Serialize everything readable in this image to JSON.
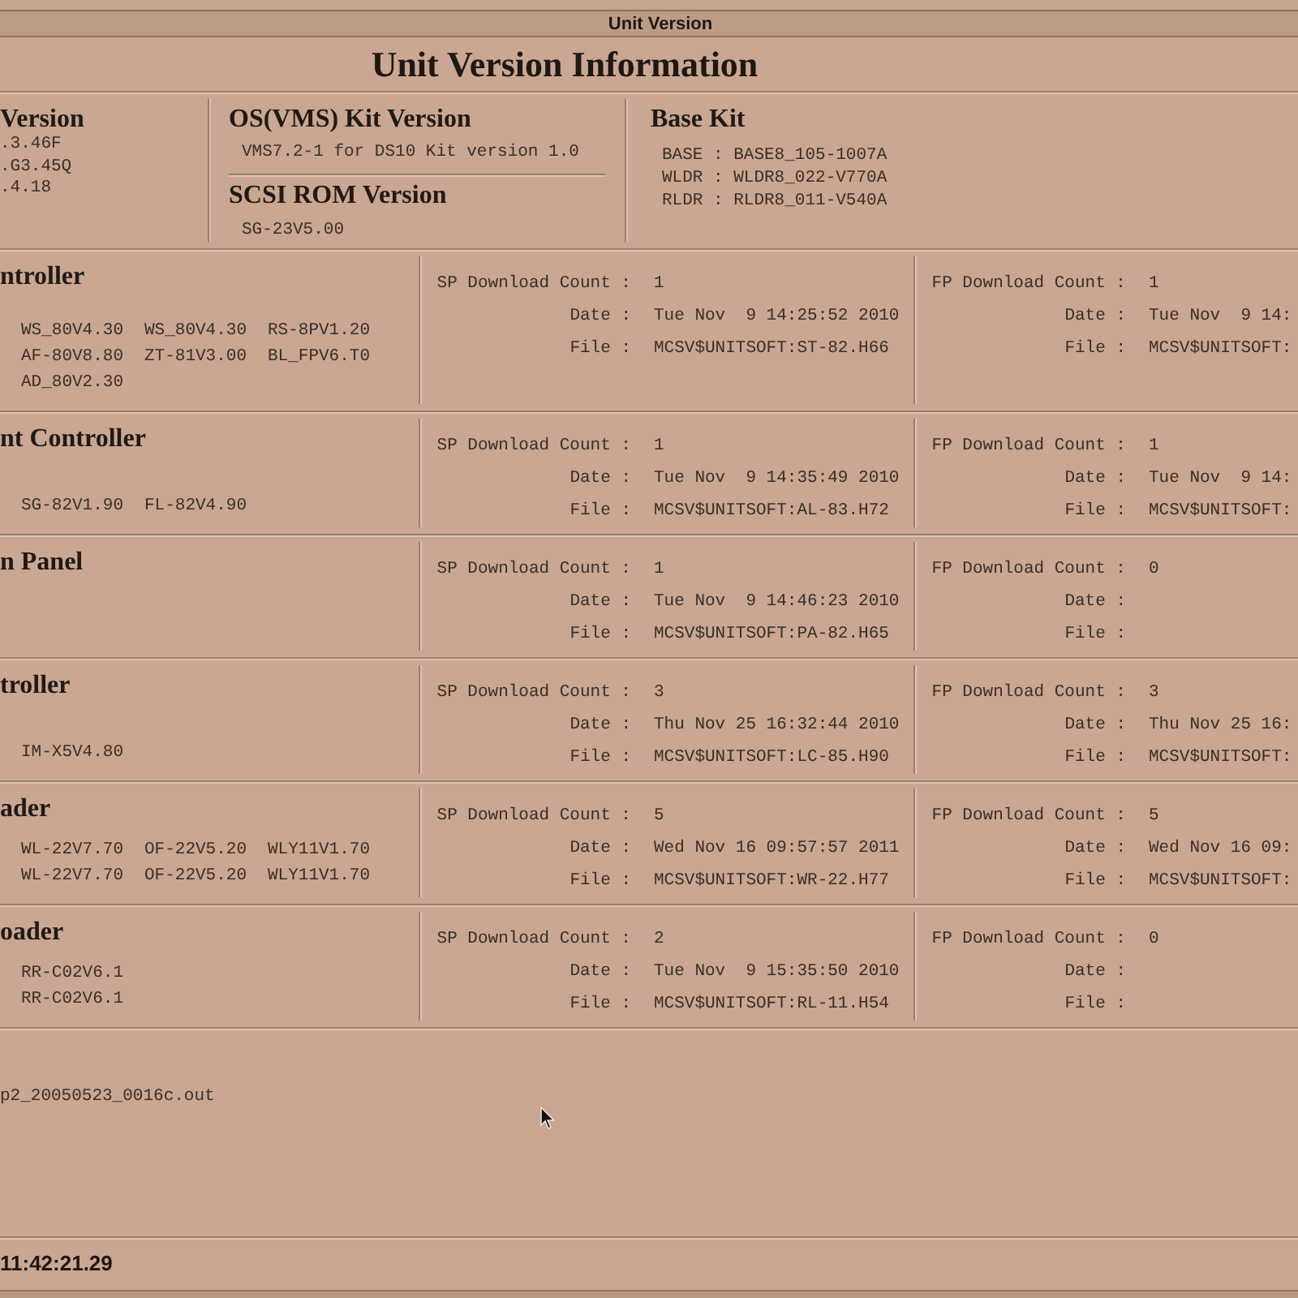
{
  "window": {
    "title": "Unit Version"
  },
  "heading": "Unit Version Information",
  "summary": {
    "columns": [
      {
        "blocks": [
          {
            "title": "Version",
            "lines": [
              ".3.46F",
              ".G3.45Q",
              ".4.18"
            ]
          }
        ]
      },
      {
        "blocks": [
          {
            "title": "OS(VMS) Kit Version",
            "lines": [
              "VMS7.2-1 for DS10 Kit version 1.0"
            ]
          },
          {
            "title": "SCSI ROM Version",
            "lines": [
              "SG-23V5.00"
            ]
          }
        ]
      },
      {
        "blocks": [
          {
            "title": "Base Kit",
            "lines": [
              "BASE : BASE8_105-1007A",
              "WLDR : WLDR8_022-V770A",
              "RLDR : RLDR8_011-V540A"
            ]
          }
        ]
      }
    ]
  },
  "units": [
    {
      "title": "ntroller",
      "versions": [
        [
          "WS_80V4.30",
          "WS_80V4.30",
          "RS-8PV1.20"
        ],
        [
          "AF-80V8.80",
          "ZT-81V3.00",
          "BL_FPV6.T0"
        ],
        [
          "AD_80V2.30"
        ]
      ],
      "sp": [
        {
          "label": "SP Download Count :",
          "value": "1"
        },
        {
          "label": "Date :",
          "value": "Tue Nov  9 14:25:52 2010"
        },
        {
          "label": "File :",
          "value": "MCSV$UNITSOFT:ST-82.H66"
        }
      ],
      "fp": [
        {
          "label": "FP Download Count :",
          "value": "1"
        },
        {
          "label": "Date :",
          "value": "Tue Nov  9 14:"
        },
        {
          "label": "File :",
          "value": "MCSV$UNITSOFT:"
        }
      ]
    },
    {
      "title": "nt Controller",
      "versions": [
        [
          "SG-82V1.90",
          "FL-82V4.90"
        ]
      ],
      "sp": [
        {
          "label": "SP Download Count :",
          "value": "1"
        },
        {
          "label": "Date :",
          "value": "Tue Nov  9 14:35:49 2010"
        },
        {
          "label": "File :",
          "value": "MCSV$UNITSOFT:AL-83.H72"
        }
      ],
      "fp": [
        {
          "label": "FP Download Count :",
          "value": "1"
        },
        {
          "label": "Date :",
          "value": "Tue Nov  9 14:"
        },
        {
          "label": "File :",
          "value": "MCSV$UNITSOFT:"
        }
      ]
    },
    {
      "title": "n Panel",
      "sp": [
        {
          "label": "SP Download Count :",
          "value": "1"
        },
        {
          "label": "Date :",
          "value": "Tue Nov  9 14:46:23 2010"
        },
        {
          "label": "File :",
          "value": "MCSV$UNITSOFT:PA-82.H65"
        }
      ],
      "fp": [
        {
          "label": "FP Download Count :",
          "value": "0"
        },
        {
          "label": "Date :"
        },
        {
          "label": "File :"
        }
      ]
    },
    {
      "title": "troller",
      "versions": [
        [
          "IM-X5V4.80"
        ]
      ],
      "sp": [
        {
          "label": "SP Download Count :",
          "value": "3"
        },
        {
          "label": "Date :",
          "value": "Thu Nov 25 16:32:44 2010"
        },
        {
          "label": "File :",
          "value": "MCSV$UNITSOFT:LC-85.H90"
        }
      ],
      "fp": [
        {
          "label": "FP Download Count :",
          "value": "3"
        },
        {
          "label": "Date :",
          "value": "Thu Nov 25 16:"
        },
        {
          "label": "File :",
          "value": "MCSV$UNITSOFT:"
        }
      ]
    },
    {
      "title": "ader",
      "versions": [
        [
          "WL-22V7.70",
          "OF-22V5.20",
          "WLY11V1.70"
        ],
        [
          "WL-22V7.70",
          "OF-22V5.20",
          "WLY11V1.70"
        ]
      ],
      "sp": [
        {
          "label": "SP Download Count :",
          "value": "5"
        },
        {
          "label": "Date :",
          "value": "Wed Nov 16 09:57:57 2011"
        },
        {
          "label": "File :",
          "value": "MCSV$UNITSOFT:WR-22.H77"
        }
      ],
      "fp": [
        {
          "label": "FP Download Count :",
          "value": "5"
        },
        {
          "label": "Date :",
          "value": "Wed Nov 16 09:"
        },
        {
          "label": "File :",
          "value": "MCSV$UNITSOFT:"
        }
      ]
    },
    {
      "title": "oader",
      "versions": [
        [
          "RR-C02V6.1"
        ],
        [
          "RR-C02V6.1"
        ]
      ],
      "sp": [
        {
          "label": "SP Download Count :",
          "value": "2"
        },
        {
          "label": "Date :",
          "value": "Tue Nov  9 15:35:50 2010"
        },
        {
          "label": "File :",
          "value": "MCSV$UNITSOFT:RL-11.H54"
        }
      ],
      "fp": [
        {
          "label": "FP Download Count :",
          "value": "0"
        },
        {
          "label": "Date :"
        },
        {
          "label": "File :"
        }
      ]
    }
  ],
  "log_file": "p2_20050523_0016c.out",
  "status_bar": {
    "time": "11:42:21.29"
  }
}
